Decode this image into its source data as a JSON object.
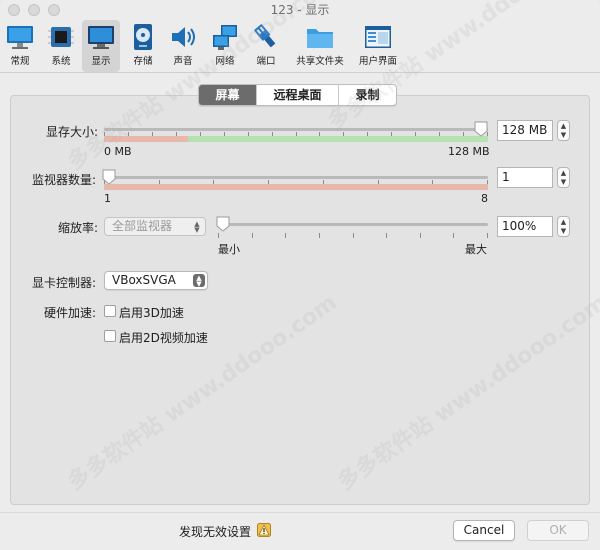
{
  "window": {
    "title": "123 - 显示"
  },
  "toolbar": {
    "items": [
      {
        "label": "常规",
        "icon": "general-icon"
      },
      {
        "label": "系统",
        "icon": "chip-icon"
      },
      {
        "label": "显示",
        "icon": "monitor-icon",
        "selected": true
      },
      {
        "label": "存储",
        "icon": "disk-icon"
      },
      {
        "label": "声音",
        "icon": "speaker-icon"
      },
      {
        "label": "网络",
        "icon": "network-icon"
      },
      {
        "label": "端口",
        "icon": "port-icon"
      },
      {
        "label": "共享文件夹",
        "icon": "folder-icon"
      },
      {
        "label": "用户界面",
        "icon": "ui-window-icon"
      }
    ]
  },
  "tabs": [
    {
      "label": "屏幕",
      "active": true
    },
    {
      "label": "远程桌面"
    },
    {
      "label": "录制"
    }
  ],
  "screen": {
    "video_memory": {
      "label": "显存大小:",
      "value": "128 MB",
      "min_label": "0 MB",
      "max_label": "128 MB",
      "fraction": 1.0
    },
    "monitor_count": {
      "label": "监视器数量:",
      "value": "1",
      "min_label": "1",
      "max_label": "8",
      "fraction": 0.0
    },
    "scale": {
      "label": "缩放率:",
      "popup_value": "全部监视器",
      "value": "100%",
      "min_label": "最小",
      "max_label": "最大",
      "fraction": 0.0
    },
    "graphics_controller": {
      "label": "显卡控制器:",
      "value": "VBoxSVGA"
    },
    "acceleration": {
      "label": "硬件加速:",
      "options": [
        {
          "label": "启用3D加速",
          "checked": false
        },
        {
          "label": "启用2D视频加速",
          "checked": false
        }
      ]
    }
  },
  "footer": {
    "invalid_settings": "发现无效设置",
    "cancel_label": "Cancel",
    "ok_label": "OK"
  },
  "watermark": {
    "text": "多多软件站 www.ddooo.com"
  },
  "colors": {
    "bar_red": "#e9b8ac",
    "bar_green": "#b6e1b0",
    "tab_active": "#6c6c6c",
    "selected_tool": "#d4d4d4"
  }
}
